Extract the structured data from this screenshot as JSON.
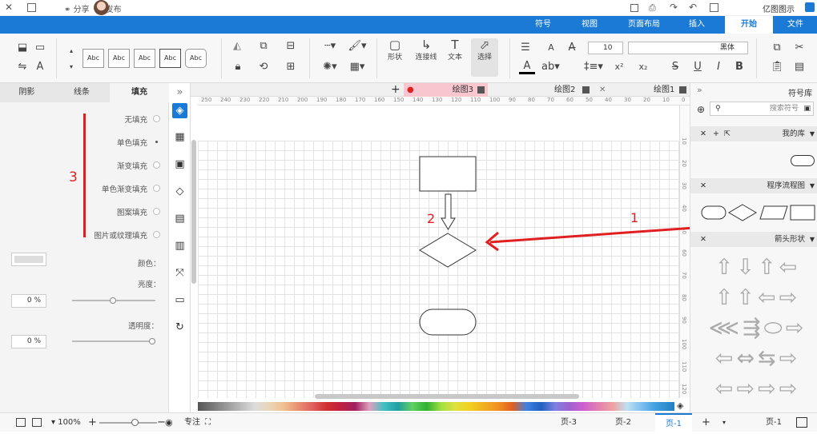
{
  "titlebar": {
    "app_name": "亿图图示",
    "publish_label": "发布",
    "share_label": "分享"
  },
  "menu_tabs": [
    {
      "label": "文件"
    },
    {
      "label": "开始"
    },
    {
      "label": "插入"
    },
    {
      "label": "页面布局"
    },
    {
      "label": "视图"
    },
    {
      "label": "符号"
    }
  ],
  "ribbon": {
    "font_name": "黑体",
    "font_size": "10",
    "style_sample": "Abc",
    "tools": {
      "select": "选择",
      "text": "文本",
      "connector": "连接线",
      "shape": "形状"
    }
  },
  "left_panel": {
    "tabs": [
      "填充",
      "线条",
      "阴影"
    ],
    "fill_options": [
      "无填充",
      "单色填充",
      "渐变填充",
      "单色渐变填充",
      "图案填充",
      "图片或纹理填充"
    ],
    "annotation_number": "3",
    "color_label": "颜色：",
    "brightness_label": "亮度：",
    "brightness_value": "0 %",
    "transparency_label": "透明度：",
    "transparency_value": "0 %"
  },
  "doc_tabs": [
    {
      "label": "绘图1"
    },
    {
      "label": "绘图2"
    },
    {
      "label": "绘图3"
    }
  ],
  "ruler_top": [
    "250",
    "240",
    "230",
    "220",
    "210",
    "200",
    "190",
    "180",
    "170",
    "160",
    "150",
    "140",
    "130",
    "120",
    "110",
    "100",
    "90",
    "80",
    "70",
    "60",
    "50",
    "40",
    "30",
    "20",
    "10",
    "0"
  ],
  "ruler_left": [
    "10",
    "20",
    "30",
    "40",
    "50",
    "60",
    "70",
    "80",
    "90",
    "100",
    "110",
    "120"
  ],
  "canvas": {
    "annotation_1": "1",
    "annotation_2": "2"
  },
  "right_panel": {
    "title": "符号库",
    "search_placeholder": "搜索符号",
    "sections": [
      "我的库",
      "程序流程图",
      "箭头形状"
    ]
  },
  "status": {
    "page_selector": "页-1",
    "pages": [
      "页-1",
      "页-2",
      "页-3"
    ],
    "focus_label": "专注",
    "zoom": "100%"
  },
  "colors": {
    "accent": "#1b7ad6",
    "annotation": "#e02020",
    "doc_tab_active": "#f7c6cf"
  }
}
